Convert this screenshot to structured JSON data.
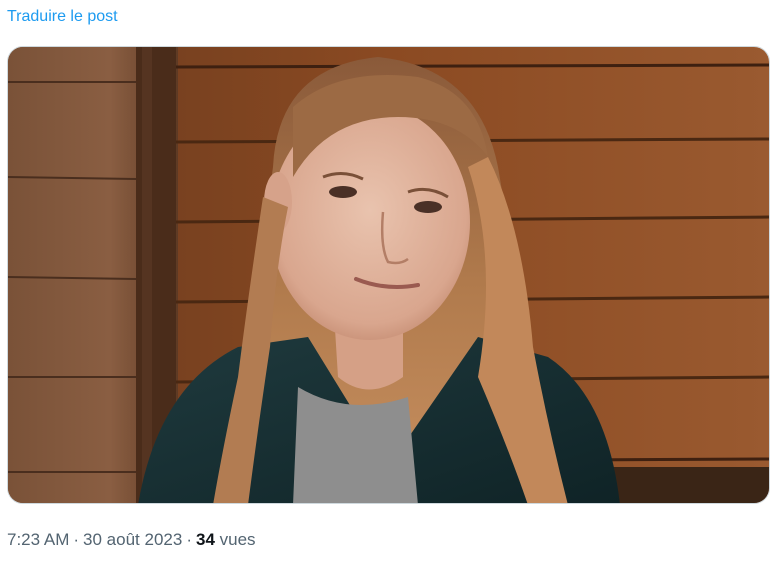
{
  "post": {
    "translate_label": "Traduire le post",
    "photo": {
      "description_icon": "portrait-photo"
    },
    "meta": {
      "time": "7:23 AM",
      "separator": "·",
      "date": "30 août 2023",
      "views_count": "34",
      "views_label": "vues"
    }
  },
  "colors": {
    "link": "#1d9bf0",
    "meta_text": "#536471",
    "count_text": "#0f1419"
  }
}
